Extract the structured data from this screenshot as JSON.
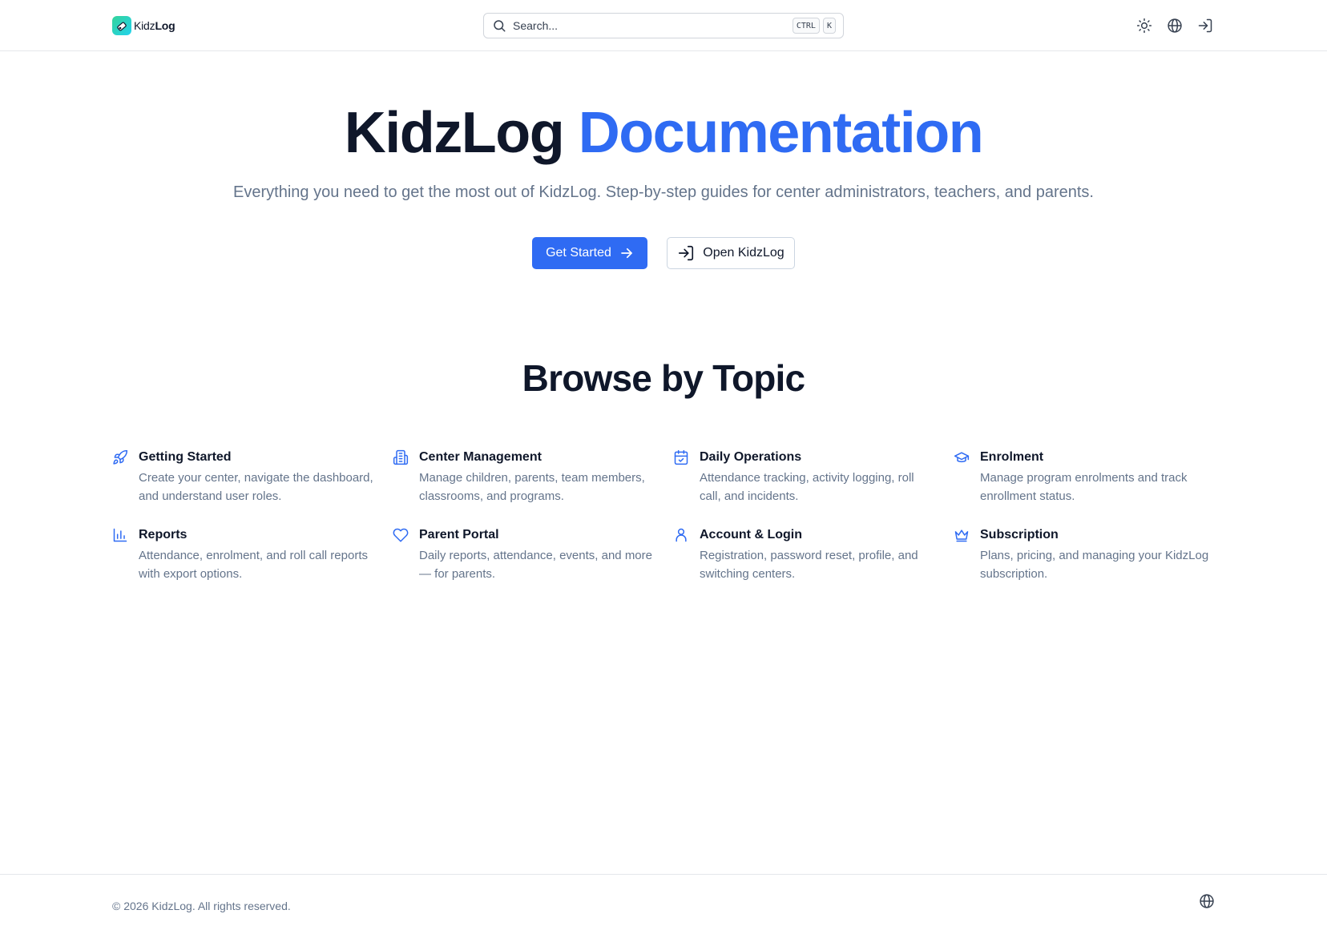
{
  "header": {
    "logo": {
      "text_light": "Kidz",
      "text_bold": "Log",
      "icon": "logo-icon"
    },
    "search": {
      "placeholder": "Search...",
      "shortcut_keys": [
        "CTRL",
        "K"
      ],
      "icon": "search-icon"
    },
    "actions": [
      {
        "name": "theme-toggle",
        "icon": "sun-icon"
      },
      {
        "name": "language",
        "icon": "globe-icon"
      },
      {
        "name": "sign-in",
        "icon": "sign-in-icon"
      }
    ]
  },
  "hero": {
    "title_main": "KidzLog",
    "title_accent": "Documentation",
    "subtitle": "Everything you need to get the most out of KidzLog. Step-by-step guides for center administrators, teachers, and parents.",
    "primary_button": "Get Started",
    "secondary_button": "Open KidzLog"
  },
  "topics": {
    "heading": "Browse by Topic",
    "items": [
      {
        "title": "Getting Started",
        "desc": "Create your center, navigate the dashboard, and understand user roles.",
        "icon": "rocket-icon"
      },
      {
        "title": "Center Management",
        "desc": "Manage children, parents, team members, classrooms, and programs.",
        "icon": "building-icon"
      },
      {
        "title": "Daily Operations",
        "desc": "Attendance tracking, activity logging, roll call, and incidents.",
        "icon": "calendar-check-icon"
      },
      {
        "title": "Enrolment",
        "desc": "Manage program enrolments and track enrollment status.",
        "icon": "graduation-cap-icon"
      },
      {
        "title": "Reports",
        "desc": "Attendance, enrolment, and roll call reports with export options.",
        "icon": "bar-chart-icon"
      },
      {
        "title": "Parent Portal",
        "desc": "Daily reports, attendance, events, and more — for parents.",
        "icon": "heart-icon"
      },
      {
        "title": "Account & Login",
        "desc": "Registration, password reset, profile, and switching centers.",
        "icon": "user-icon"
      },
      {
        "title": "Subscription",
        "desc": "Plans, pricing, and managing your KidzLog subscription.",
        "icon": "crown-icon"
      }
    ]
  },
  "footer": {
    "copyright": "© 2026 KidzLog. All rights reserved.",
    "icon": "globe-icon"
  },
  "colors": {
    "accent": "#2f6bf3",
    "text": "#0f172a",
    "muted": "#64748b",
    "border": "#e5e7eb"
  }
}
